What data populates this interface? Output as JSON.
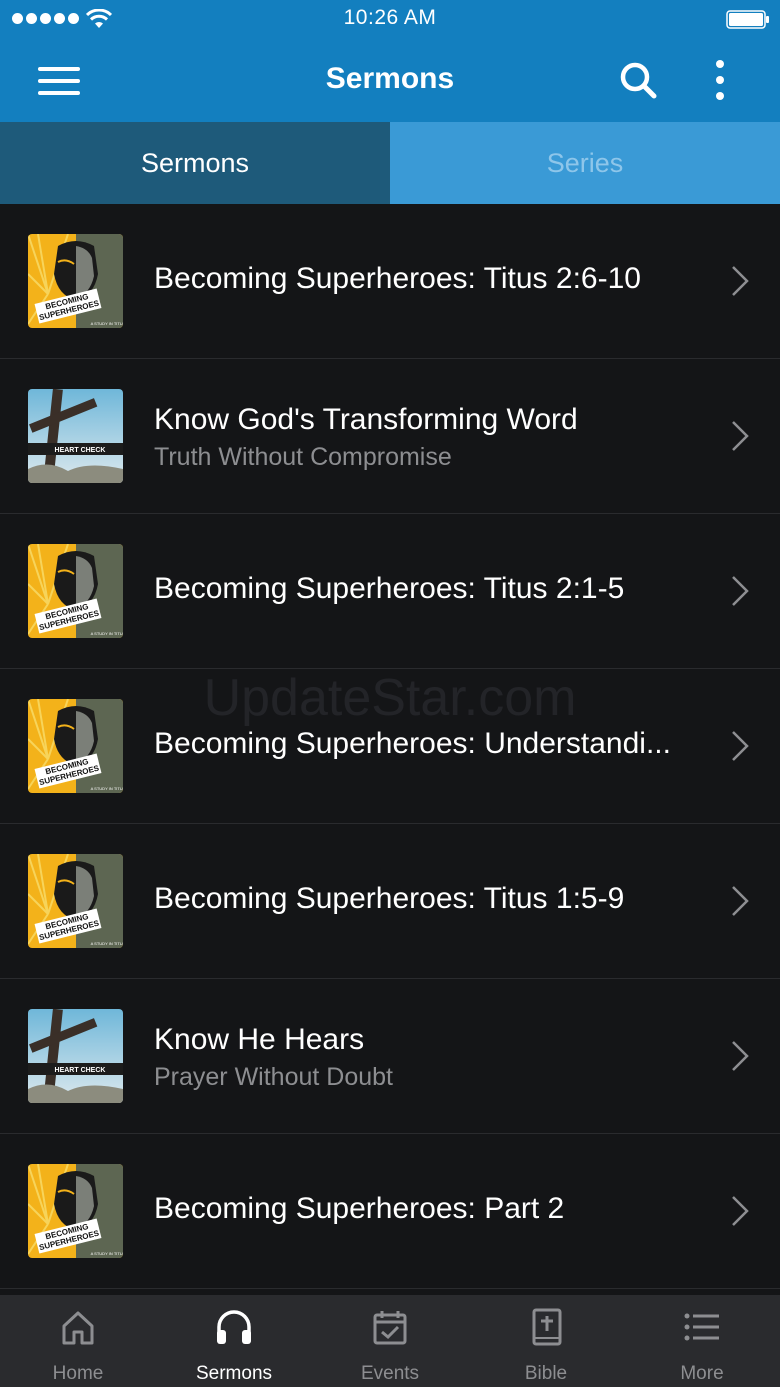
{
  "status_bar": {
    "time": "10:26 AM"
  },
  "navbar": {
    "title": "Sermons"
  },
  "tabs": [
    {
      "label": "Sermons",
      "active": true
    },
    {
      "label": "Series",
      "active": false
    }
  ],
  "sermons": [
    {
      "title": "Becoming Superheroes: Titus 2:6-10",
      "subtitle": "",
      "thumb": "superheroes"
    },
    {
      "title": "Know God's Transforming Word",
      "subtitle": "Truth Without Compromise",
      "thumb": "heart-check"
    },
    {
      "title": "Becoming Superheroes: Titus 2:1-5",
      "subtitle": "",
      "thumb": "superheroes"
    },
    {
      "title": "Becoming Superheroes: Understandi...",
      "subtitle": "",
      "thumb": "superheroes"
    },
    {
      "title": "Becoming Superheroes: Titus 1:5-9",
      "subtitle": "",
      "thumb": "superheroes"
    },
    {
      "title": "Know He Hears",
      "subtitle": "Prayer Without Doubt",
      "thumb": "heart-check"
    },
    {
      "title": "Becoming Superheroes: Part 2",
      "subtitle": "",
      "thumb": "superheroes"
    }
  ],
  "thumbnail_text": {
    "superheroes_line1": "BECOMING",
    "superheroes_line2": "SUPERHEROES",
    "superheroes_tag": "A STUDY IN TITUS",
    "heart_check": "HEART CHECK"
  },
  "watermark": "UpdateStar.com",
  "tabbar": [
    {
      "label": "Home",
      "icon": "home-icon",
      "active": false
    },
    {
      "label": "Sermons",
      "icon": "headphones-icon",
      "active": true
    },
    {
      "label": "Events",
      "icon": "calendar-check-icon",
      "active": false
    },
    {
      "label": "Bible",
      "icon": "bible-icon",
      "active": false
    },
    {
      "label": "More",
      "icon": "list-icon",
      "active": false
    }
  ],
  "colors": {
    "primary": "#137fbf",
    "tab_active_bg": "#1e5a7a",
    "tab_inactive_bg": "#3a9ad6",
    "background": "#141517",
    "tabbar_bg": "#2a2b2e",
    "muted_text": "#8d8e91"
  }
}
